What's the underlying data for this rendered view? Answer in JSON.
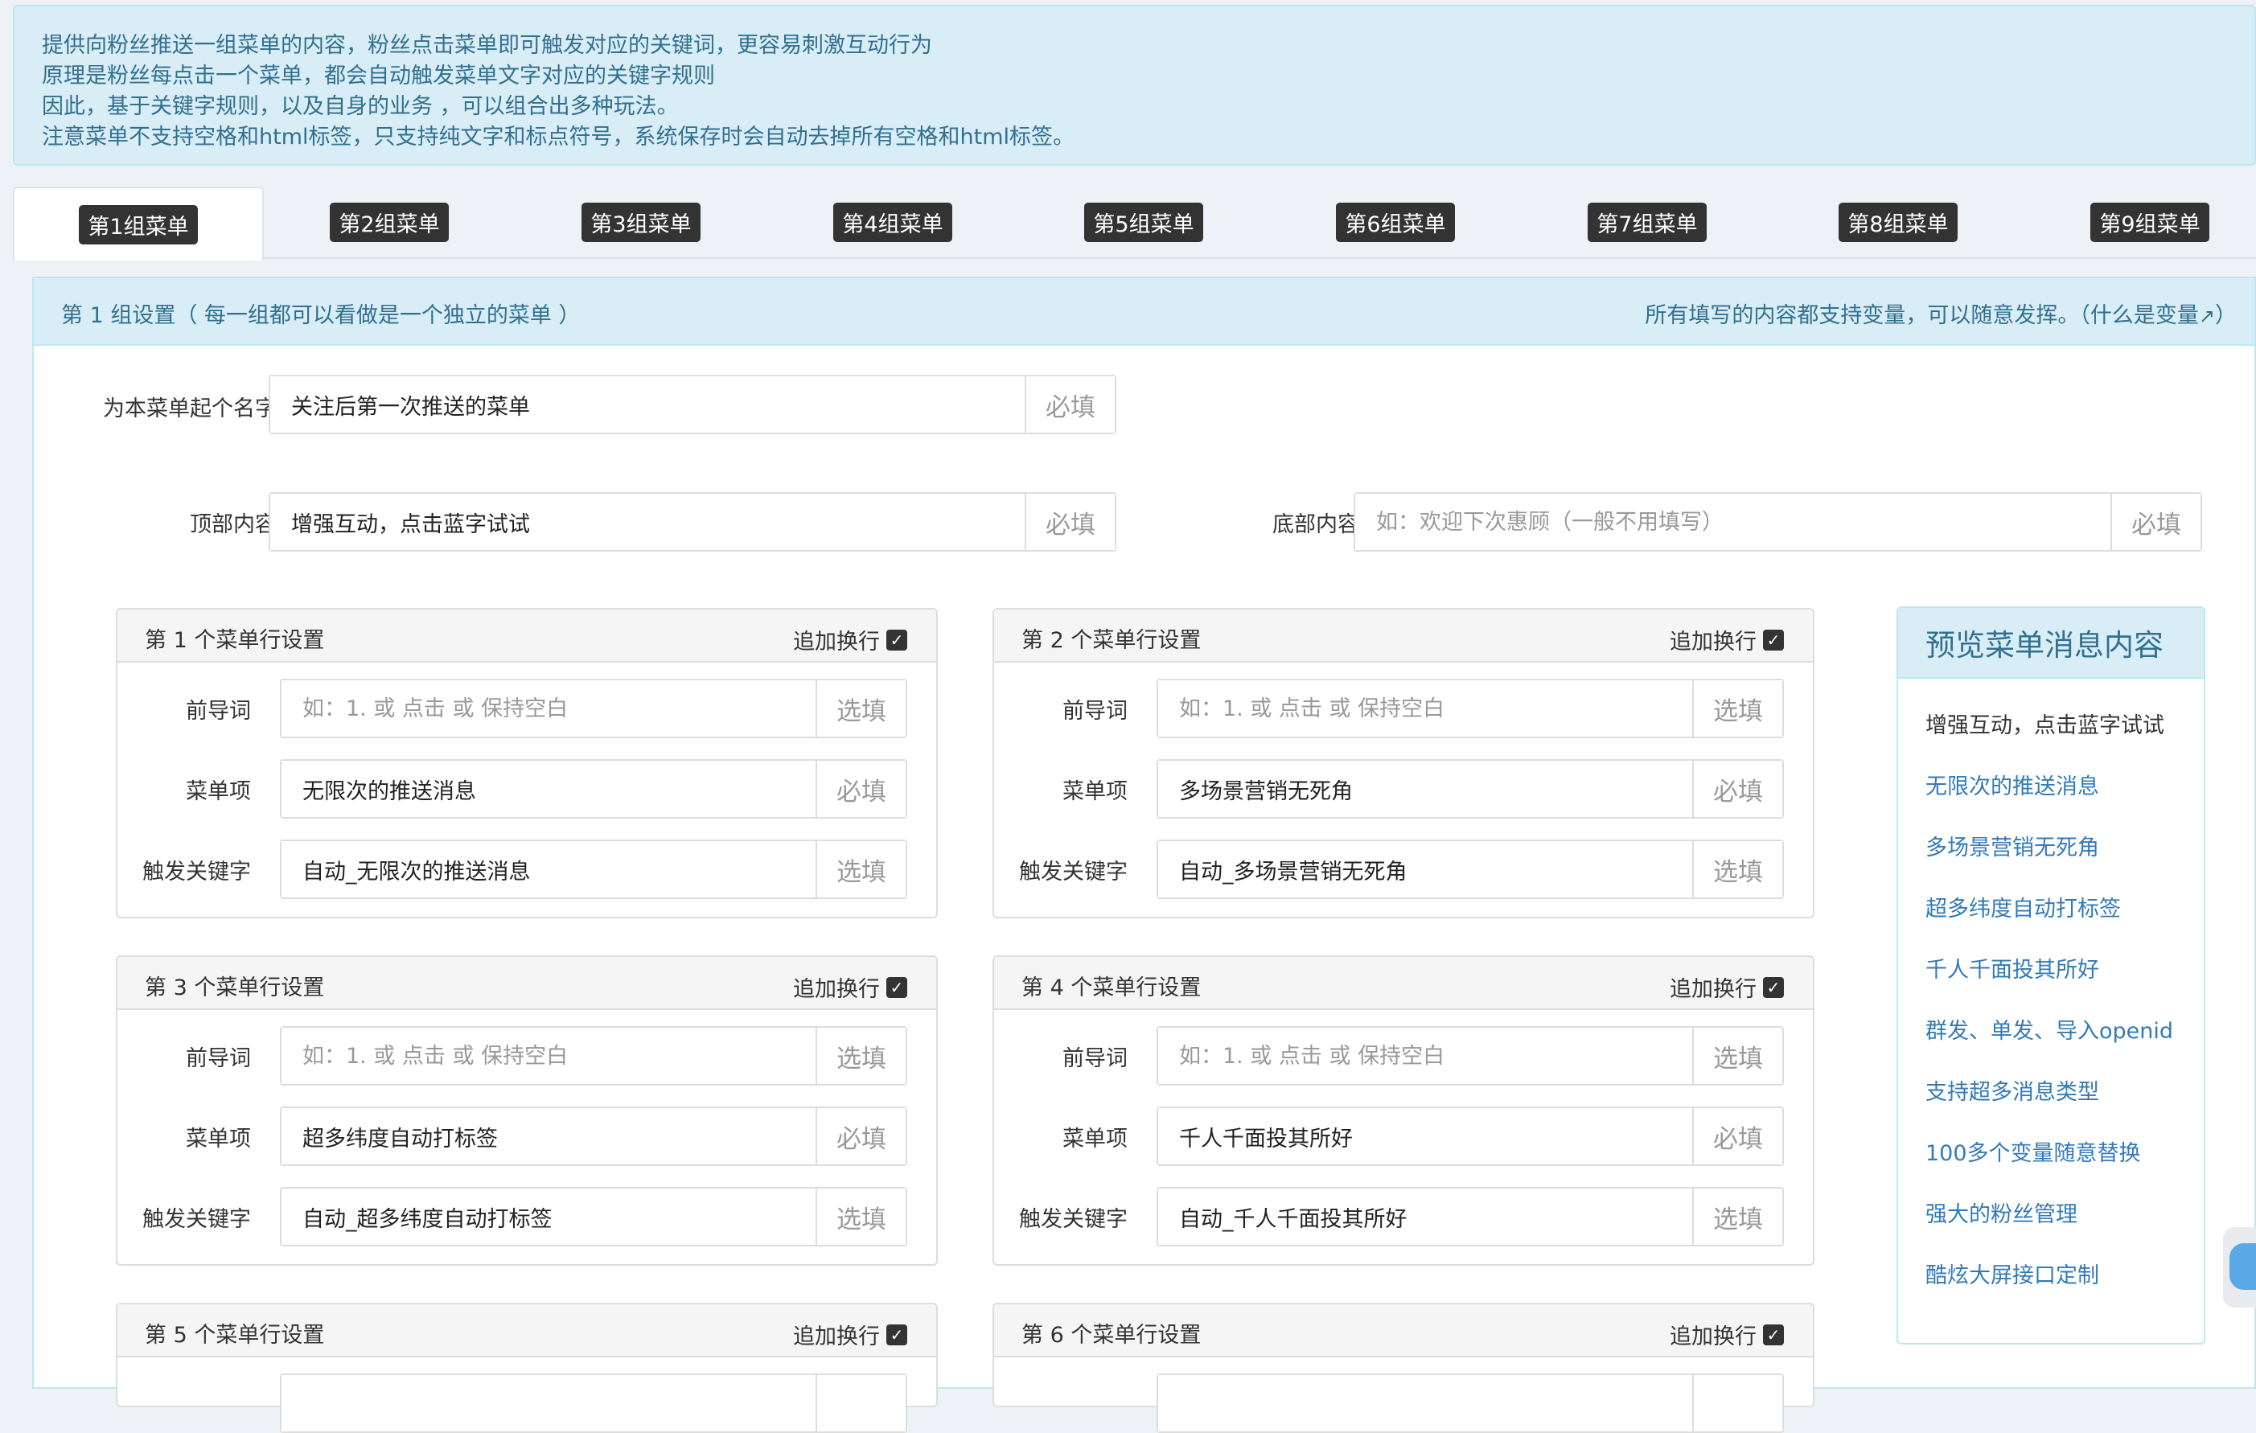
{
  "alert": {
    "lines": [
      "提供向粉丝推送一组菜单的内容，粉丝点击菜单即可触发对应的关键词，更容易刺激互动行为",
      "原理是粉丝每点击一个菜单，都会自动触发菜单文字对应的关键字规则",
      "因此，基于关键字规则，以及自身的业务 ，可以组合出多种玩法。",
      "注意菜单不支持空格和html标签，只支持纯文字和标点符号，系统保存时会自动去掉所有空格和html标签。"
    ]
  },
  "tabs": [
    "第1组菜单",
    "第2组菜单",
    "第3组菜单",
    "第4组菜单",
    "第5组菜单",
    "第6组菜单",
    "第7组菜单",
    "第8组菜单",
    "第9组菜单"
  ],
  "active_tab": "第1组菜单",
  "panel": {
    "title": "第 1 组设置（ 每一组都可以看做是一个独立的菜单 ）",
    "note": "所有填写的内容都支持变量，可以随意发挥。（什么是变量",
    "note_end": "）",
    "name_label": "为本菜单起个名字",
    "name_value": "关注后第一次推送的菜单",
    "top_label": "顶部内容",
    "top_value": "增强互动，点击蓝字试试",
    "bottom_label": "底部内容",
    "bottom_placeholder": "如：欢迎下次惠顾（一般不用填写）",
    "required": "必填",
    "optional": "选填"
  },
  "row_labels": {
    "prefix": "前导词",
    "item": "菜单项",
    "keyword": "触发关键字",
    "newline": "追加换行",
    "prefix_placeholder": "如：1. 或 点击 或 保持空白"
  },
  "rows": [
    {
      "title": "第 1 个菜单行设置",
      "item": "无限次的推送消息",
      "keyword": "自动_无限次的推送消息"
    },
    {
      "title": "第 2 个菜单行设置",
      "item": "多场景营销无死角",
      "keyword": "自动_多场景营销无死角"
    },
    {
      "title": "第 3 个菜单行设置",
      "item": "超多纬度自动打标签",
      "keyword": "自动_超多纬度自动打标签"
    },
    {
      "title": "第 4 个菜单行设置",
      "item": "千人千面投其所好",
      "keyword": "自动_千人千面投其所好"
    },
    {
      "title": "第 5 个菜单行设置"
    },
    {
      "title": "第 6 个菜单行设置"
    }
  ],
  "preview": {
    "title": "预览菜单消息内容",
    "intro": "增强互动，点击蓝字试试",
    "links": [
      "无限次的推送消息",
      "多场景营销无死角",
      "超多纬度自动打标签",
      "千人千面投其所好",
      "群发、单发、导入openid",
      "支持超多消息类型",
      "100多个变量随意替换",
      "强大的粉丝管理",
      "酷炫大屏接口定制"
    ]
  },
  "colors": {
    "info_bg": "#d9edf7",
    "info_text": "#31708f",
    "link": "#337ab7",
    "badge": "#333333"
  }
}
